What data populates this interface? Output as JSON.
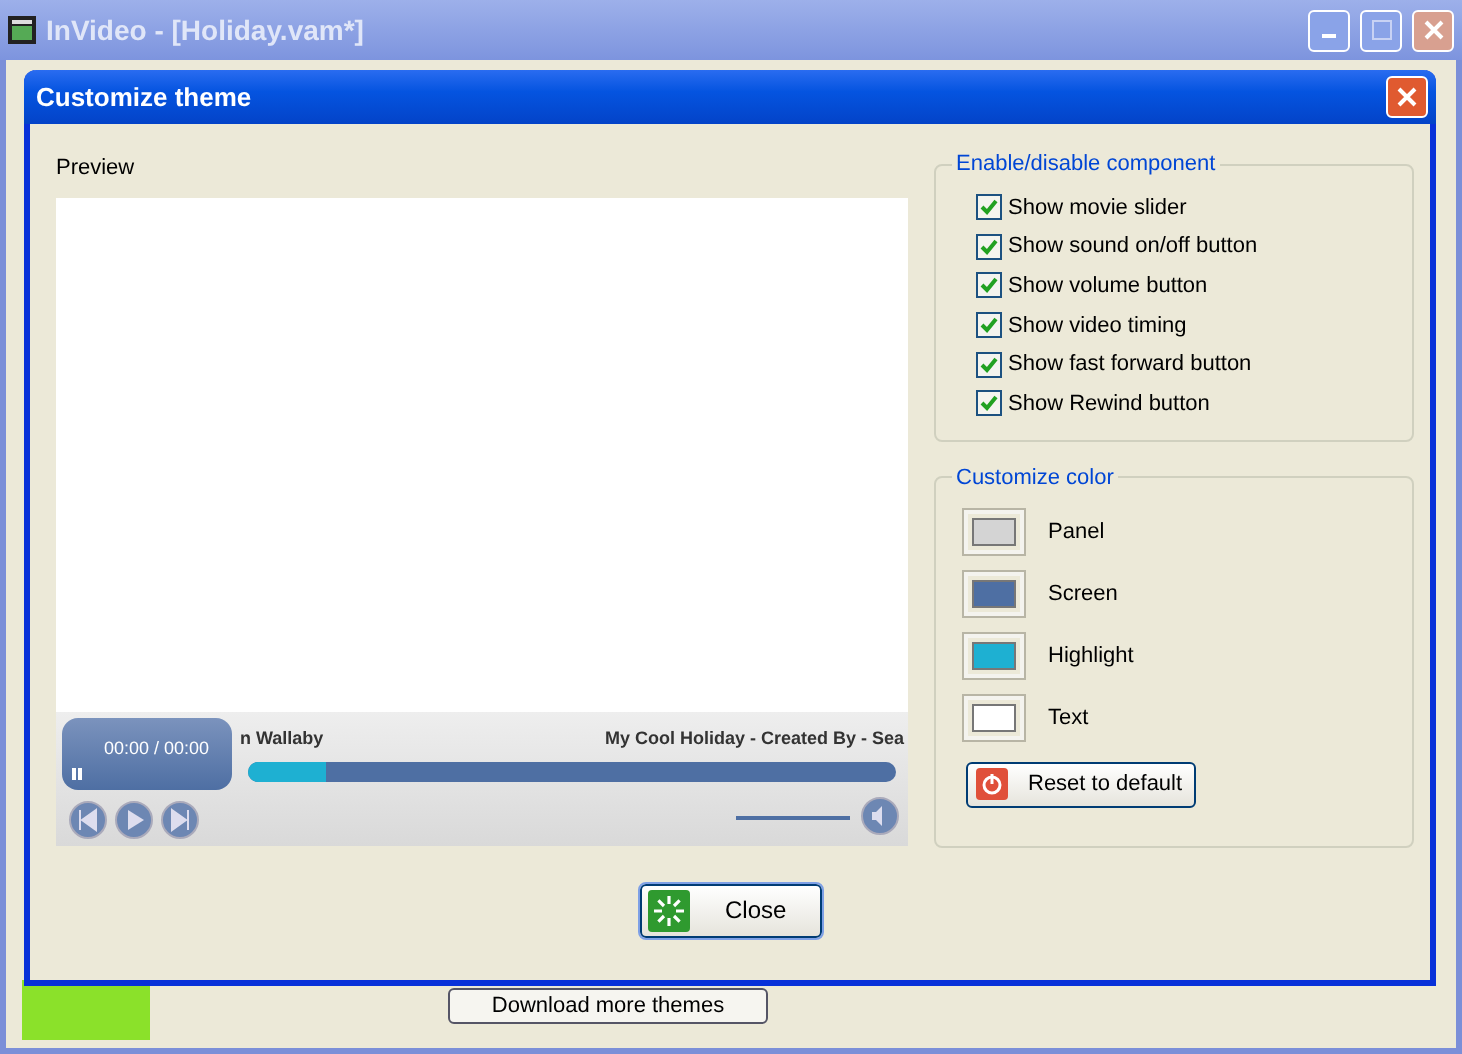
{
  "window": {
    "title": "InVideo - [Holiday.vam*]",
    "download_button": "Download more themes"
  },
  "dialog": {
    "title": "Customize theme",
    "preview_label": "Preview",
    "player": {
      "time": "00:00 / 00:00",
      "left_caption": "n Wallaby",
      "right_caption": "My Cool Holiday - Created By - Sea",
      "progress": {
        "level": 0.12
      },
      "volume": {
        "level": 0.95
      }
    },
    "components": {
      "title": "Enable/disable component",
      "items": [
        {
          "label": "Show movie slider",
          "checked": true
        },
        {
          "label": "Show sound on/off button",
          "checked": true
        },
        {
          "label": "Show volume button",
          "checked": true
        },
        {
          "label": "Show video timing",
          "checked": true
        },
        {
          "label": "Show fast forward button",
          "checked": true
        },
        {
          "label": "Show Rewind button",
          "checked": true
        }
      ]
    },
    "colors": {
      "title": "Customize color",
      "items": [
        {
          "label": "Panel",
          "color": "#d4d4d4"
        },
        {
          "label": "Screen",
          "color": "#4e6fa3"
        },
        {
          "label": "Highlight",
          "color": "#1eb0d2"
        },
        {
          "label": "Text",
          "color": "#ffffff"
        }
      ],
      "reset_button": "Reset to default"
    },
    "close_button": "Close"
  }
}
